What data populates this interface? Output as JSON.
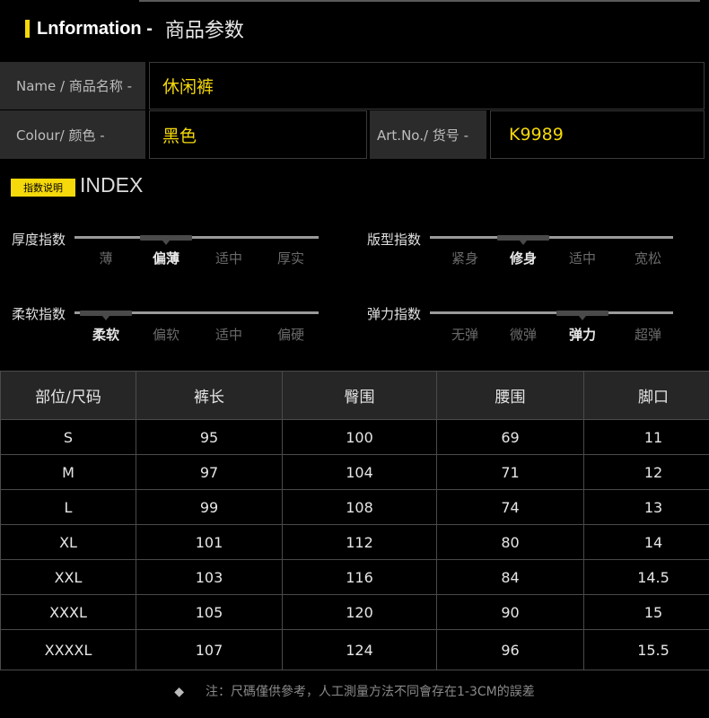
{
  "header": {
    "title_en": "Lnformation -",
    "title_cn": "商品参数"
  },
  "info": {
    "name_label": "Name / 商品名称 -",
    "name_value": "休闲裤",
    "colour_label": "Colour/ 颜色 -",
    "colour_value": "黑色",
    "artno_label": "Art.No./ 货号 -",
    "artno_value": "K9989"
  },
  "index": {
    "badge": "指数说明",
    "title": "INDEX",
    "scales": [
      {
        "name": "厚度指数",
        "options": [
          "薄",
          "偏薄",
          "适中",
          "厚实"
        ],
        "selected": "偏薄"
      },
      {
        "name": "版型指数",
        "options": [
          "紧身",
          "修身",
          "适中",
          "宽松"
        ],
        "selected": "修身"
      },
      {
        "name": "柔软指数",
        "options": [
          "柔软",
          "偏软",
          "适中",
          "偏硬"
        ],
        "selected": "柔软"
      },
      {
        "name": "弹力指数",
        "options": [
          "无弹",
          "微弹",
          "弹力",
          "超弹"
        ],
        "selected": "弹力"
      }
    ]
  },
  "size_table": {
    "headers": [
      "部位/尺码",
      "裤长",
      "臀围",
      "腰围",
      "脚口"
    ],
    "rows": [
      [
        "S",
        "95",
        "100",
        "69",
        "11"
      ],
      [
        "M",
        "97",
        "104",
        "71",
        "12"
      ],
      [
        "L",
        "99",
        "108",
        "74",
        "13"
      ],
      [
        "XL",
        "101",
        "112",
        "80",
        "14"
      ],
      [
        "XXL",
        "103",
        "116",
        "84",
        "14.5"
      ],
      [
        "XXXL",
        "105",
        "120",
        "90",
        "15"
      ],
      [
        "XXXXL",
        "107",
        "124",
        "96",
        "15.5"
      ]
    ]
  },
  "note": {
    "icon": "diamond-bullet-icon",
    "text": "注：尺碼僅供參考，人工測量方法不同會存在1-3CM的誤差"
  },
  "colors": {
    "accent": "#f5d90a",
    "label_bg": "#2b2b2b",
    "background": "#000000"
  }
}
